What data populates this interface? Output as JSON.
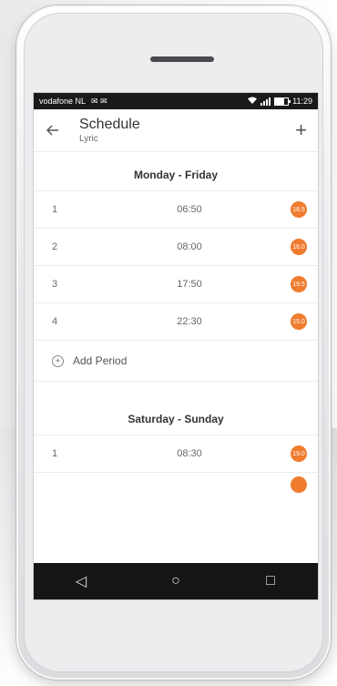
{
  "statusbar": {
    "carrier": "vodafone NL",
    "icons": "✉ ✉",
    "time": "11:29"
  },
  "appbar": {
    "back_icon": "arrow-left-icon",
    "title": "Schedule",
    "subtitle": "Lyric",
    "add_icon": "+"
  },
  "weekday": {
    "heading": "Monday - Friday",
    "periods": [
      {
        "num": "1",
        "time": "06:50",
        "temp": "18.5"
      },
      {
        "num": "2",
        "time": "08:00",
        "temp": "16.0"
      },
      {
        "num": "3",
        "time": "17:50",
        "temp": "19.5"
      },
      {
        "num": "4",
        "time": "22:30",
        "temp": "15.0"
      }
    ],
    "add_period_label": "Add Period",
    "add_period_icon": "+"
  },
  "weekend": {
    "heading": "Saturday - Sunday",
    "periods": [
      {
        "num": "1",
        "time": "08:30",
        "temp": "19.0"
      }
    ]
  },
  "colors": {
    "accent": "#f07c2f",
    "statusbar": "#1a1a1a",
    "navbar": "#151515"
  },
  "navbar": {
    "back_icon": "◁",
    "home_icon": "○",
    "recents_icon": "□"
  }
}
